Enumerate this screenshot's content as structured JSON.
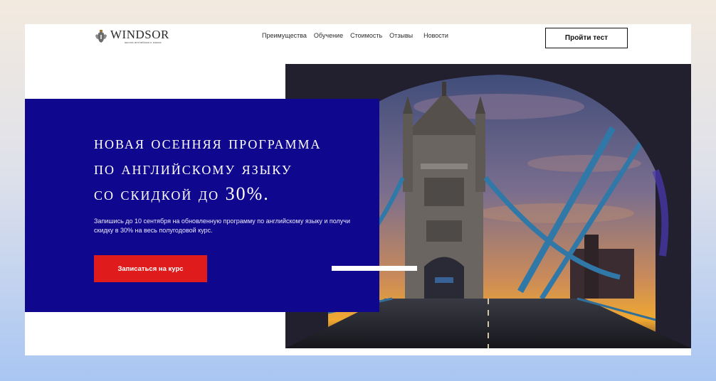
{
  "header": {
    "logo_title": "WINDSOR",
    "logo_subtitle": "школа английского языка",
    "nav": [
      "Преимущества",
      "Обучение",
      "Стоимость",
      "Отзывы",
      "Новости"
    ],
    "test_button": "Пройти тест"
  },
  "hero": {
    "title_lines": [
      "Новая осенняя программа",
      "по английскому языку",
      "со скидкой до 30%."
    ],
    "description": "Запишись до 10 сентября на обновленную программу по английскому языку и получи скидку в 30% на весь полугодовой курс.",
    "cta": "Записаться на курс"
  },
  "colors": {
    "promo_bg": "#10078f",
    "cta_bg": "#e01b1b"
  }
}
